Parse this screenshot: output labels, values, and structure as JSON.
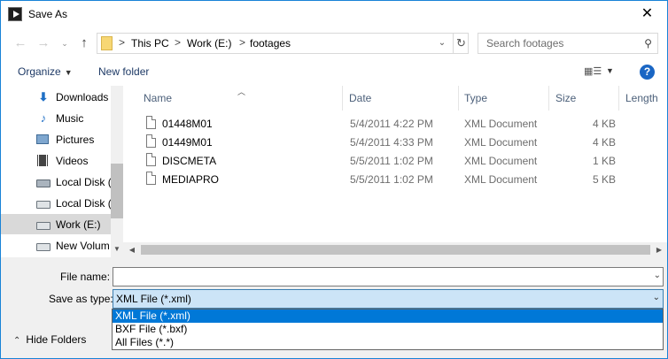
{
  "window": {
    "title": "Save As"
  },
  "address": {
    "crumbs": [
      "This PC",
      "Work (E:)",
      "footages"
    ],
    "separator": ">"
  },
  "search": {
    "placeholder": "Search footages"
  },
  "toolbar": {
    "organize_label": "Organize",
    "new_folder_label": "New folder"
  },
  "nav": {
    "items": [
      {
        "label": "Downloads",
        "icon": "downloads-icon"
      },
      {
        "label": "Music",
        "icon": "music-icon"
      },
      {
        "label": "Pictures",
        "icon": "pictures-icon"
      },
      {
        "label": "Videos",
        "icon": "videos-icon"
      },
      {
        "label": "Local Disk (",
        "icon": "local-disk-icon"
      },
      {
        "label": "Local Disk (",
        "icon": "local-disk-icon"
      },
      {
        "label": "Work (E:)",
        "icon": "drive-icon",
        "selected": true
      },
      {
        "label": "New Volum",
        "icon": "drive-icon"
      }
    ]
  },
  "files": {
    "columns": [
      "Name",
      "Date",
      "Type",
      "Size",
      "Length"
    ],
    "rows": [
      {
        "name": "01448M01",
        "date": "5/4/2011 4:22 PM",
        "type": "XML Document",
        "size": "4 KB"
      },
      {
        "name": "01449M01",
        "date": "5/4/2011 4:33 PM",
        "type": "XML Document",
        "size": "4 KB"
      },
      {
        "name": "DISCMETA",
        "date": "5/5/2011 1:02 PM",
        "type": "XML Document",
        "size": "1 KB"
      },
      {
        "name": "MEDIAPRO",
        "date": "5/5/2011 1:02 PM",
        "type": "XML Document",
        "size": "5 KB"
      }
    ]
  },
  "form": {
    "file_name_label": "File name:",
    "file_name_value": "",
    "save_as_type_label": "Save as type:",
    "save_as_type_value": "XML File (*.xml)",
    "type_options": [
      "XML File (*.xml)",
      "BXF File (*.bxf)",
      "All Files (*.*)"
    ],
    "selected_option_index": 0,
    "hide_folders_label": "Hide Folders"
  },
  "colors": {
    "accent": "#0078d7",
    "selection": "#cce4f7",
    "nav_selected": "#d9d9d9"
  }
}
